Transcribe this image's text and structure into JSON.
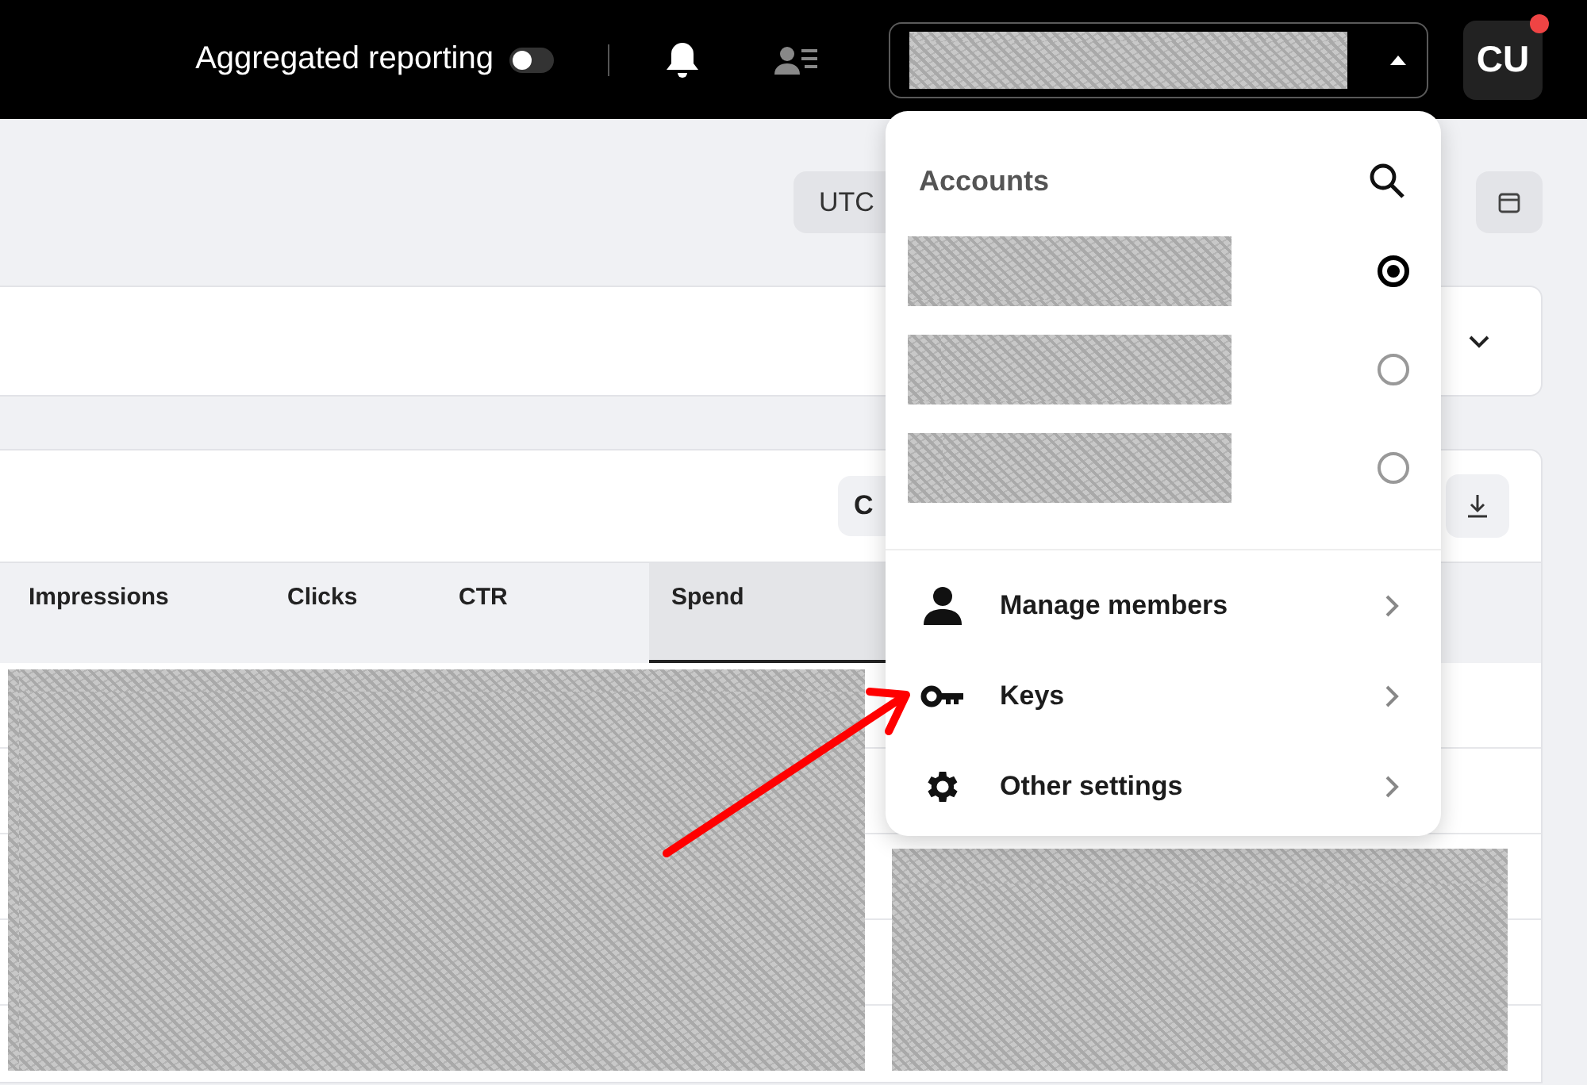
{
  "top_bar": {
    "aggregated_reporting": {
      "label": "Aggregated reporting",
      "on": false
    },
    "account_switcher": {
      "expanded": true
    },
    "avatar": {
      "initials": "CU",
      "notification": true
    }
  },
  "toolbar": {
    "timezone": "UTC"
  },
  "table": {
    "action_button": "C",
    "columns": [
      {
        "label": "Impressions",
        "sorted": false
      },
      {
        "label": "Clicks",
        "sorted": false
      },
      {
        "label": "CTR",
        "sorted": false
      },
      {
        "label": "Spend",
        "sorted": true
      }
    ]
  },
  "account_menu": {
    "title": "Accounts",
    "accounts": [
      {
        "selected": true
      },
      {
        "selected": false
      },
      {
        "selected": false
      }
    ],
    "items": [
      {
        "label": "Manage members",
        "kind": "person"
      },
      {
        "label": "Keys",
        "kind": "key"
      },
      {
        "label": "Other settings",
        "kind": "gear"
      }
    ]
  }
}
